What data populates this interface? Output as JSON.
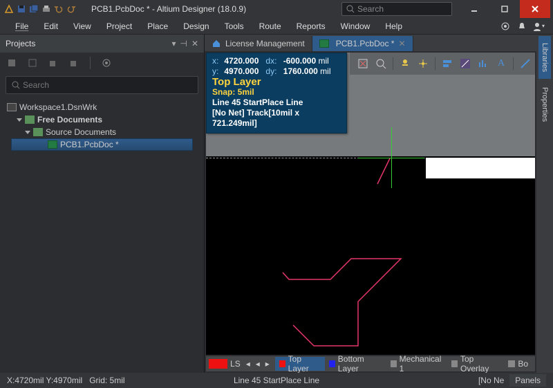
{
  "titlebar": {
    "title": "PCB1.PcbDoc * - Altium Designer (18.0.9)",
    "search_placeholder": "Search"
  },
  "menu": [
    "File",
    "Edit",
    "View",
    "Project",
    "Place",
    "Design",
    "Tools",
    "Route",
    "Reports",
    "Window",
    "Help"
  ],
  "projects": {
    "panel_title": "Projects",
    "search_placeholder": "Search",
    "workspace": "Workspace1.DsnWrk",
    "free_docs": "Free Documents",
    "source_docs": "Source Documents",
    "pcb_doc": "PCB1.PcbDoc *"
  },
  "editor_tabs": {
    "license": "License Management",
    "pcb": "PCB1.PcbDoc *"
  },
  "hud": {
    "x_label": "x:",
    "x_val": "4720.000",
    "dx_label": "dx:",
    "dx_val": "-600.000",
    "unit": "mil",
    "y_label": "y:",
    "y_val": "4970.000",
    "dy_label": "dy:",
    "dy_val": "1760.000",
    "layer": "Top Layer",
    "snap": "Snap: 5mil",
    "line": "Line 45 StartPlace Line",
    "net": "[No Net] Track[10mil x 721.249mil]"
  },
  "layer_strip": {
    "ls": "LS",
    "top": "Top Layer",
    "bottom": "Bottom Layer",
    "mech": "Mechanical 1",
    "overlay": "Top Overlay",
    "bo": "Bo"
  },
  "side_tabs": [
    "Libraries",
    "Properties"
  ],
  "status": {
    "coords": "X:4720mil Y:4970mil",
    "grid": "Grid: 5mil",
    "center": "Line 45 StartPlace Line",
    "net": "[No Ne",
    "panels": "Panels"
  }
}
